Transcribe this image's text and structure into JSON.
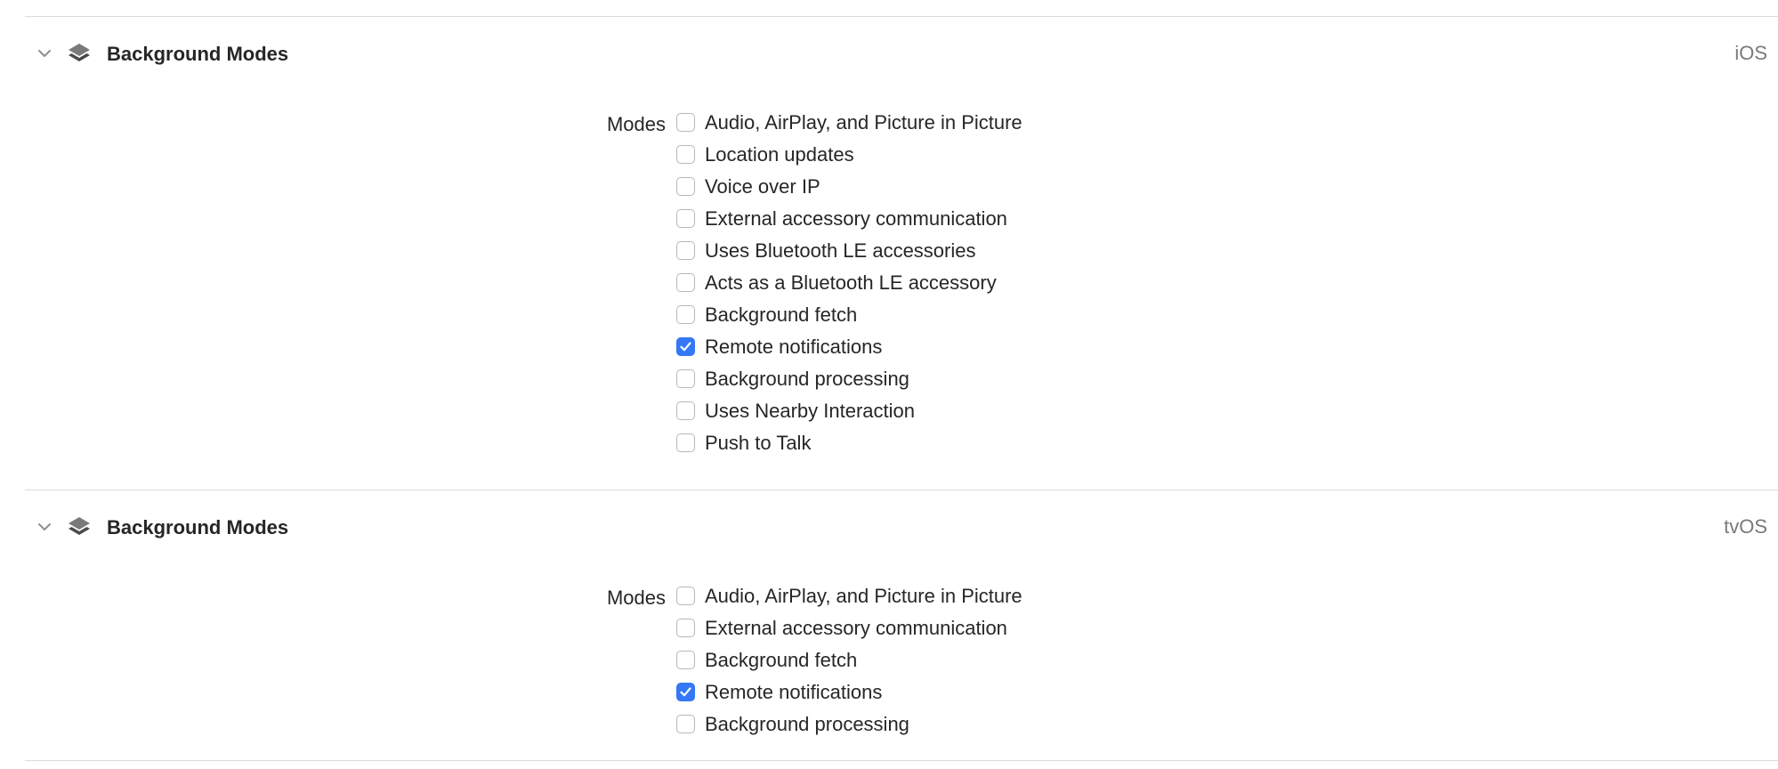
{
  "sections": [
    {
      "title": "Background Modes",
      "platform": "iOS",
      "modes_label": "Modes",
      "options": [
        {
          "label": "Audio, AirPlay, and Picture in Picture",
          "checked": false
        },
        {
          "label": "Location updates",
          "checked": false
        },
        {
          "label": "Voice over IP",
          "checked": false
        },
        {
          "label": "External accessory communication",
          "checked": false
        },
        {
          "label": "Uses Bluetooth LE accessories",
          "checked": false
        },
        {
          "label": "Acts as a Bluetooth LE accessory",
          "checked": false
        },
        {
          "label": "Background fetch",
          "checked": false
        },
        {
          "label": "Remote notifications",
          "checked": true
        },
        {
          "label": "Background processing",
          "checked": false
        },
        {
          "label": "Uses Nearby Interaction",
          "checked": false
        },
        {
          "label": "Push to Talk",
          "checked": false
        }
      ]
    },
    {
      "title": "Background Modes",
      "platform": "tvOS",
      "modes_label": "Modes",
      "options": [
        {
          "label": "Audio, AirPlay, and Picture in Picture",
          "checked": false
        },
        {
          "label": "External accessory communication",
          "checked": false
        },
        {
          "label": "Background fetch",
          "checked": false
        },
        {
          "label": "Remote notifications",
          "checked": true
        },
        {
          "label": "Background processing",
          "checked": false
        }
      ]
    }
  ],
  "icons": {
    "collapse": "chevron-down-icon",
    "capability": "layers-icon",
    "checkmark": "checkmark-icon"
  },
  "colors": {
    "checkbox_checked": "#3478f6",
    "platform_text": "#7a7a7a",
    "divider": "#dcdcdc"
  }
}
